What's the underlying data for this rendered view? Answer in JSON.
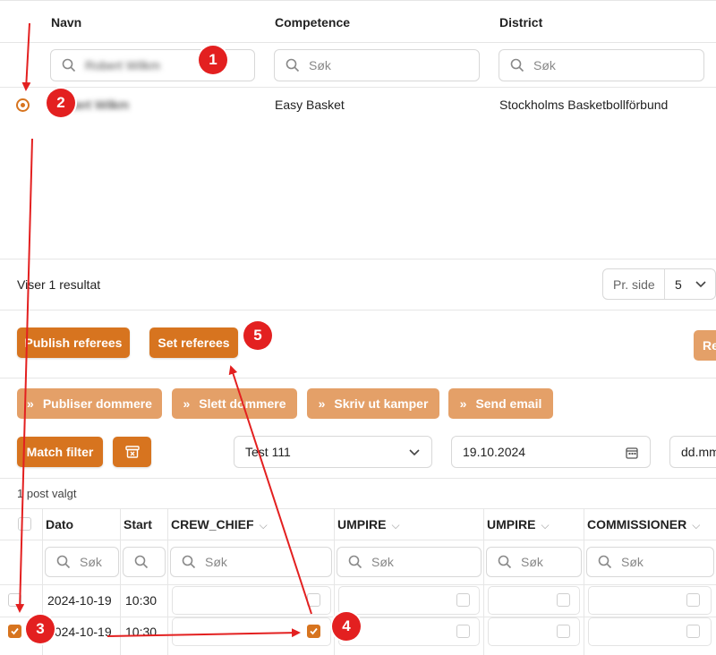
{
  "top_table": {
    "headers": {
      "name": "Navn",
      "competence": "Competence",
      "district": "District"
    },
    "search": {
      "name_value": "Robert Wilkm",
      "competence_placeholder": "Søk",
      "district_placeholder": "Søk"
    },
    "row": {
      "name": "Robert Wilkm",
      "competence": "Easy Basket",
      "district": "Stockholms Basketbollförbund"
    }
  },
  "pagination": {
    "result_text": "Viser 1 resultat",
    "per_page_label": "Pr. side",
    "per_page_value": "5"
  },
  "actions": {
    "publish_referees": "Publish referees",
    "set_referees": "Set referees",
    "re_label": "Re",
    "publiser_dommere": "Publiser dommere",
    "slett_dommere": "Slett dommere",
    "skriv_ut_kamper": "Skriv ut kamper",
    "send_email": "Send email",
    "match_filter": "Match filter"
  },
  "filters": {
    "select_value": "Test 111",
    "date_value": "19.10.2024",
    "date2_placeholder": "dd.mm"
  },
  "selection_text": "1 post valgt",
  "bottom_table": {
    "headers": {
      "date": "Dato",
      "start": "Start",
      "crew_chief": "CREW_CHIEF",
      "umpire1": "UMPIRE",
      "umpire2": "UMPIRE",
      "commissioner": "COMMISSIONER"
    },
    "search_placeholder": "Søk",
    "rows": [
      {
        "date": "2024-10-19",
        "start": "10:30"
      },
      {
        "date": "2024-10-19",
        "start": "10:30"
      }
    ]
  },
  "annotations": {
    "b1": "1",
    "b2": "2",
    "b3": "3",
    "b4": "4",
    "b5": "5"
  },
  "colors": {
    "accent": "#d7741f",
    "accent_light": "#e4a068",
    "annotation": "#e32020"
  }
}
